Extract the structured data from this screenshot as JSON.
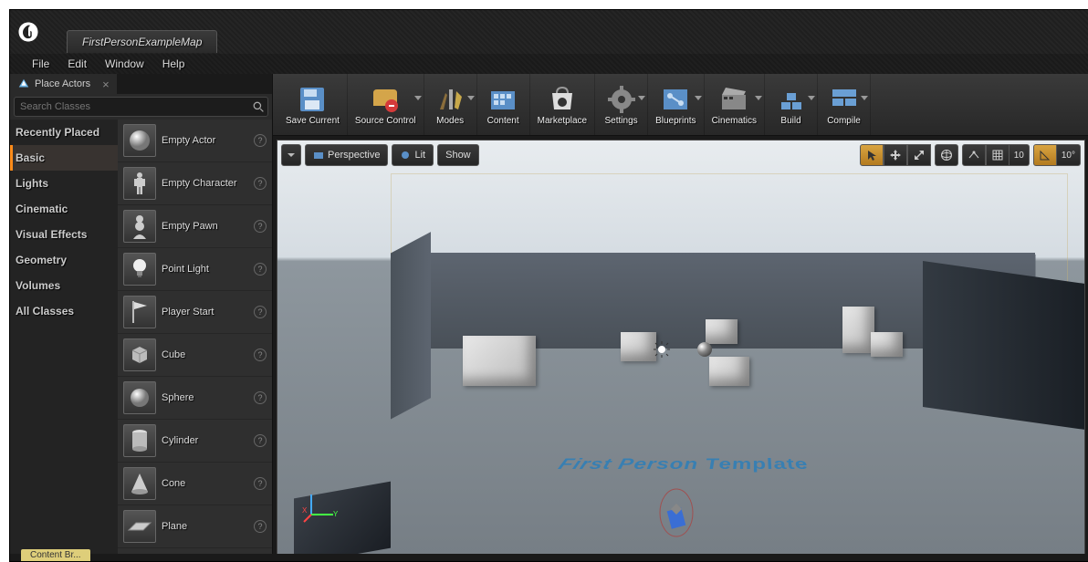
{
  "tab_title": "FirstPersonExampleMap",
  "menu": {
    "file": "File",
    "edit": "Edit",
    "window": "Window",
    "help": "Help"
  },
  "place_actors": {
    "title": "Place Actors",
    "search_placeholder": "Search Classes",
    "categories": [
      "Recently Placed",
      "Basic",
      "Lights",
      "Cinematic",
      "Visual Effects",
      "Geometry",
      "Volumes",
      "All Classes"
    ],
    "active_category": "Basic",
    "items": [
      "Empty Actor",
      "Empty Character",
      "Empty Pawn",
      "Point Light",
      "Player Start",
      "Cube",
      "Sphere",
      "Cylinder",
      "Cone",
      "Plane"
    ]
  },
  "toolbar": [
    "Save Current",
    "Source Control",
    "Modes",
    "Content",
    "Marketplace",
    "Settings",
    "Blueprints",
    "Cinematics",
    "Build",
    "Compile"
  ],
  "viewport": {
    "dropdown": "Perspective",
    "lit": "Lit",
    "show": "Show",
    "snap_pos": "10",
    "snap_rot": "10°",
    "floor_text": "First Person Template"
  },
  "bottom_tab": "Content Br..."
}
